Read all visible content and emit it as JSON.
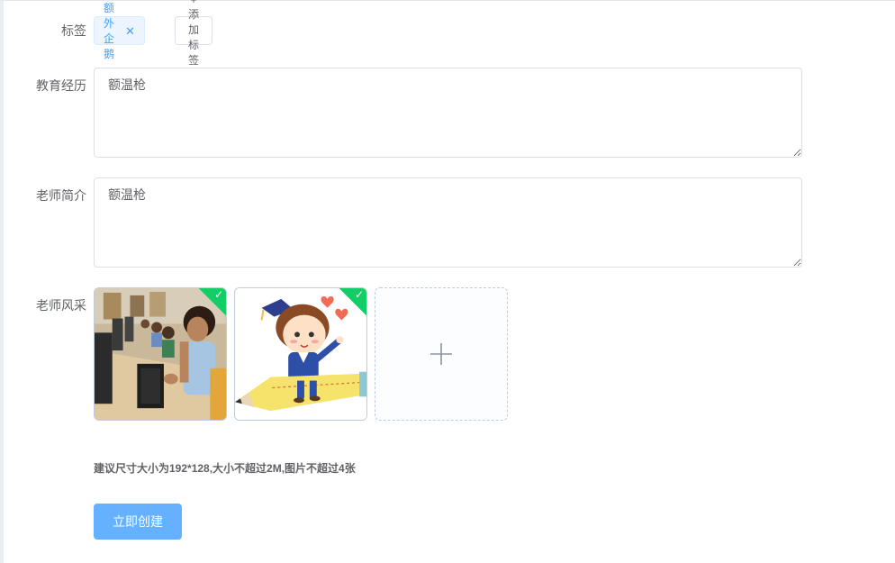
{
  "form": {
    "tags_label": "标签",
    "tags": [
      {
        "text": "额外企鹅"
      }
    ],
    "add_tag_label": "+ 添加标签",
    "education_label": "教育经历",
    "education_value": "额温枪",
    "intro_label": "老师简介",
    "intro_value": "额温枪",
    "photos_label": "老师风采",
    "upload_hint": "建议尺寸大小为192*128,大小不超过2M,图片不超过4张",
    "submit_label": "立即创建"
  },
  "colors": {
    "primary_light": "#66b1ff",
    "tag_bg": "#ecf5ff",
    "tag_text": "#409eff",
    "success": "#13ce66"
  },
  "icons": {
    "tag_close": "close-icon",
    "upload": "plus-icon",
    "uploaded": "check-icon"
  }
}
